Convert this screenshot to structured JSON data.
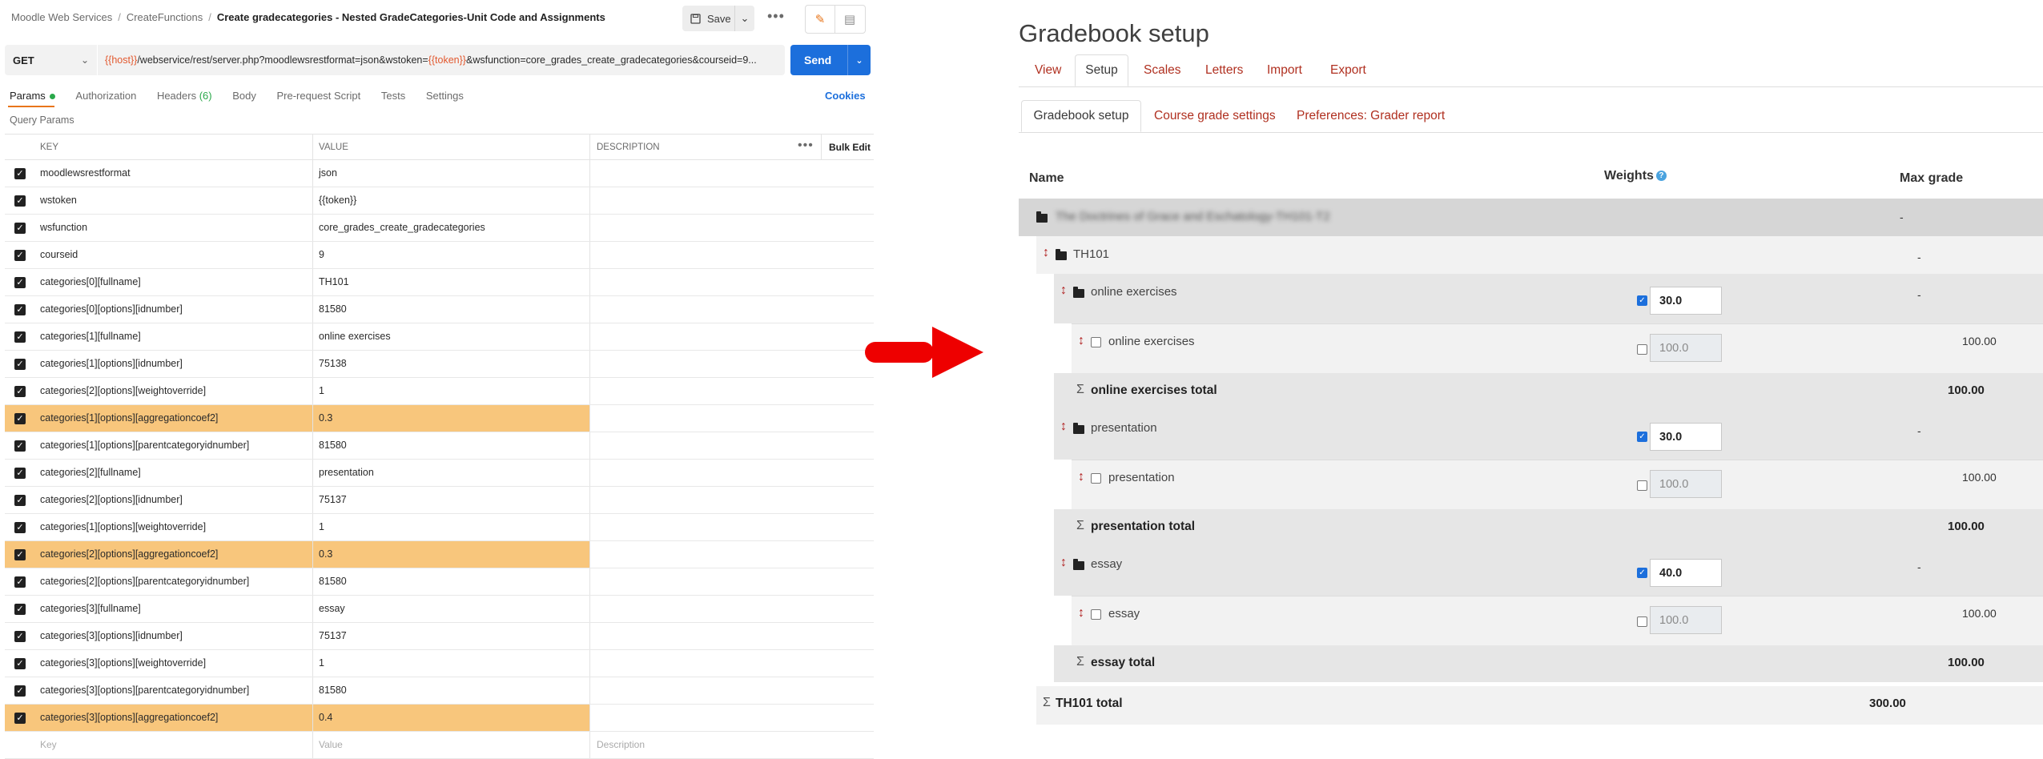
{
  "postman": {
    "breadcrumb": {
      "workspace": "Moodle Web Services",
      "collection": "CreateFunctions",
      "request": "Create gradecategories - Nested GradeCategories-Unit Code and Assignments"
    },
    "save_label": "Save",
    "method": "GET",
    "url": {
      "p1": "{{host}}",
      "p2": "/webservice/rest/server.php?moodlewsrestformat=json&wstoken=",
      "p3": "{{token}}",
      "p4": "&wsfunction=core_grades_create_gradecategories&courseid=9..."
    },
    "send_label": "Send",
    "tabs": {
      "params": "Params",
      "authorization": "Authorization",
      "headers": "Headers",
      "headers_count": "(6)",
      "body": "Body",
      "prerequest": "Pre-request Script",
      "tests": "Tests",
      "settings": "Settings"
    },
    "cookies_label": "Cookies",
    "query_params_label": "Query Params",
    "table": {
      "key": "KEY",
      "value": "VALUE",
      "description": "DESCRIPTION",
      "bulk_edit": "Bulk Edit"
    },
    "rows": [
      {
        "key": "moodlewsrestformat",
        "value": "json"
      },
      {
        "key": "wstoken",
        "value": "{{token}}"
      },
      {
        "key": "wsfunction",
        "value": "core_grades_create_gradecategories"
      },
      {
        "key": "courseid",
        "value": "9"
      },
      {
        "key": "categories[0][fullname]",
        "value": "TH101"
      },
      {
        "key": "categories[0][options][idnumber]",
        "value": "81580"
      },
      {
        "key": "categories[1][fullname]",
        "value": "online exercises"
      },
      {
        "key": "categories[1][options][idnumber]",
        "value": "75138"
      },
      {
        "key": "categories[2][options][weightoverride]",
        "value": "1"
      },
      {
        "key": "categories[1][options][aggregationcoef2]",
        "value": "0.3"
      },
      {
        "key": "categories[1][options][parentcategoryidnumber]",
        "value": "81580"
      },
      {
        "key": "categories[2][fullname]",
        "value": "presentation"
      },
      {
        "key": "categories[2][options][idnumber]",
        "value": "75137"
      },
      {
        "key": "categories[1][options][weightoverride]",
        "value": "1"
      },
      {
        "key": "categories[2][options][aggregationcoef2]",
        "value": "0.3"
      },
      {
        "key": "categories[2][options][parentcategoryidnumber]",
        "value": "81580"
      },
      {
        "key": "categories[3][fullname]",
        "value": "essay"
      },
      {
        "key": "categories[3][options][idnumber]",
        "value": "75137"
      },
      {
        "key": "categories[3][options][weightoverride]",
        "value": "1"
      },
      {
        "key": "categories[3][options][parentcategoryidnumber]",
        "value": "81580"
      },
      {
        "key": "categories[3][options][aggregationcoef2]",
        "value": "0.4"
      }
    ],
    "placeholder": {
      "key": "Key",
      "value": "Value",
      "description": "Description"
    },
    "colors": {
      "accent_orange": "#e8751a",
      "send_blue": "#1c6fdc",
      "highlight": "#f8c67c",
      "var_red": "#e2582e",
      "ok_green": "#2aa84a"
    }
  },
  "moodle": {
    "title": "Gradebook setup",
    "tabs": [
      "View",
      "Setup",
      "Scales",
      "Letters",
      "Import",
      "Export"
    ],
    "subtabs": [
      "Gradebook setup",
      "Course grade settings",
      "Preferences: Grader report"
    ],
    "col_name": "Name",
    "col_weights": "Weights",
    "col_max": "Max grade",
    "course_name": "The Doctrines of Grace and Eschatology-TH101-T2",
    "course_max": "-",
    "th101": {
      "name": "TH101",
      "max": "-",
      "total_label": "TH101 total",
      "total_max": "300.00"
    },
    "categories": [
      {
        "name": "online exercises",
        "weight": "30.0",
        "max": "-",
        "item": "online exercises",
        "item_weight": "100.0",
        "item_max": "100.00",
        "total_label": "online exercises total",
        "total_max": "100.00"
      },
      {
        "name": "presentation",
        "weight": "30.0",
        "max": "-",
        "item": "presentation",
        "item_weight": "100.0",
        "item_max": "100.00",
        "total_label": "presentation total",
        "total_max": "100.00"
      },
      {
        "name": "essay",
        "weight": "40.0",
        "max": "-",
        "item": "essay",
        "item_weight": "100.0",
        "item_max": "100.00",
        "total_label": "essay total",
        "total_max": "100.00"
      }
    ],
    "colors": {
      "link_red": "#b03020",
      "band_dark": "#d6d6d6",
      "band_mid": "#e6e6e6",
      "band_light": "#f2f2f2",
      "check_blue": "#1c6fdc"
    }
  },
  "arrow_color": "#ee0000"
}
